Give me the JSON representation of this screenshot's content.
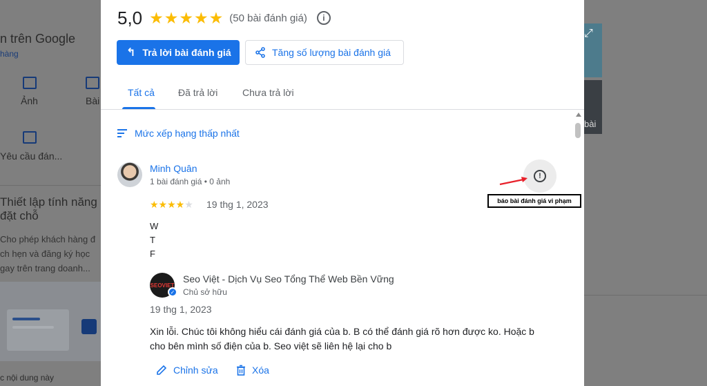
{
  "background": {
    "left": {
      "title_fragment": "n trên Google",
      "sub_fragment": "hàng",
      "photos_label": "Ảnh",
      "posts_fragment": "Bài",
      "request_fragment": "Yêu cầu đán...",
      "section_title_line1": "Thiết lập tính năng",
      "section_title_line2": "đặt chỗ",
      "section_body_line1": "Cho phép khách hàng đ",
      "section_body_line2": "ch hẹn và đăng ký học",
      "section_body_line3": "gay trên trang doanh...",
      "footer_fragment": "c nội dung này"
    },
    "right": {
      "photo_caption_fragment": "bài"
    }
  },
  "summary": {
    "rating": "5,0",
    "stars": "★★★★★",
    "count": "(50 bài đánh giá)"
  },
  "actions": {
    "reply_label": "Trả lời bài đánh giá",
    "increase_label": "Tăng số lượng bài đánh giá"
  },
  "tabs": [
    {
      "label": "Tất cả"
    },
    {
      "label": "Đã trả lời"
    },
    {
      "label": "Chưa trả lời"
    }
  ],
  "sort": {
    "label": "Mức xếp hạng thấp nhất"
  },
  "review": {
    "author": "Minh Quân",
    "meta": "1 bài đánh giá • 0 ảnh",
    "rating": 4,
    "stars_on": "★★★★",
    "stars_off": "★",
    "date": "19 thg 1, 2023",
    "text_lines": [
      "W",
      "T",
      "F"
    ]
  },
  "owner_reply": {
    "logo_text": "SEOVIET",
    "name": "Seo Việt - Dịch Vụ Seo Tổng Thể Web Bền Vững",
    "role": "Chủ sở hữu",
    "date": "19 thg 1, 2023",
    "text_line1": "Xin lỗi. Chúc tôi không hiểu cái đánh giá của b. B có thể đánh giá rõ hơn được ko. Hoặc b",
    "text_line2": "cho bên mình số điện của b. Seo việt sẽ liên hệ lại cho b",
    "edit_label": "Chỉnh sửa",
    "delete_label": "Xóa"
  },
  "annotation": {
    "label": "báo bài đánh giá vi phạm",
    "color": "#e8202a"
  },
  "colors": {
    "accent": "#1a73e8",
    "star": "#fbbc04",
    "overlay": "#7f7f7f"
  }
}
